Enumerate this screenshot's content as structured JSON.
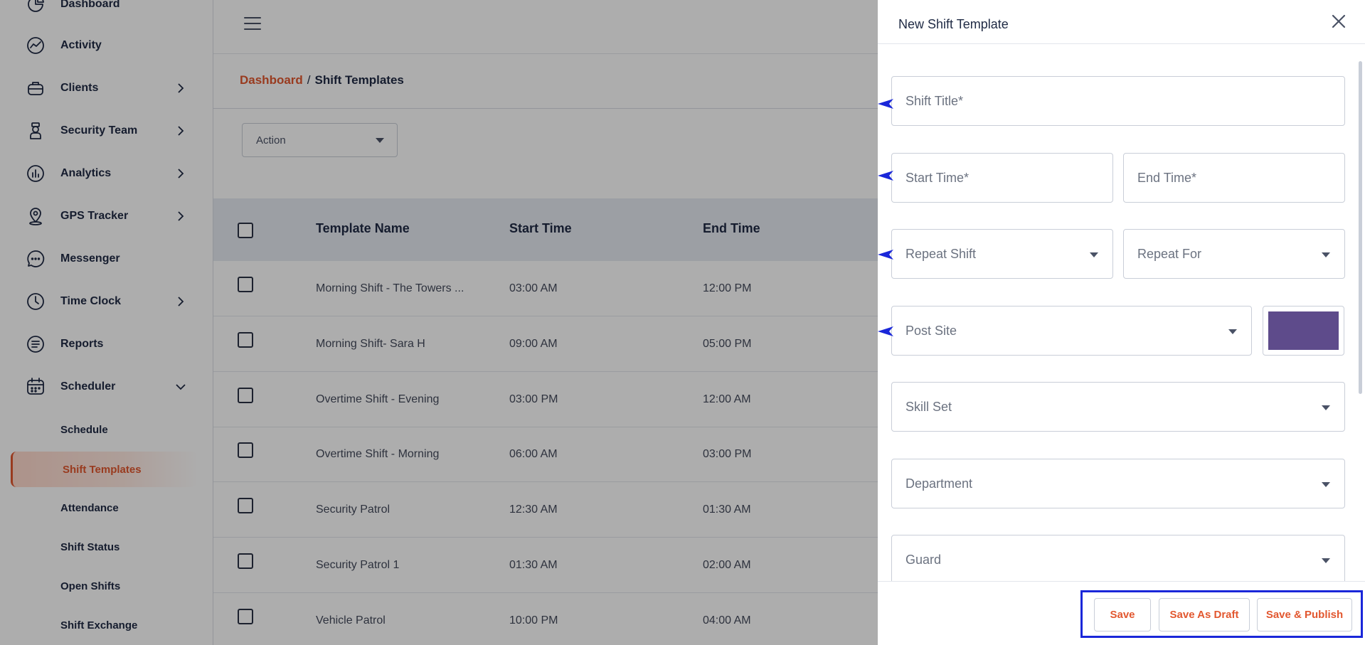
{
  "sidebar": {
    "items": [
      {
        "label": "Dashboard",
        "icon": "dashboard-icon"
      },
      {
        "label": "Activity",
        "icon": "activity-icon"
      },
      {
        "label": "Clients",
        "icon": "briefcase-icon",
        "expandable": true
      },
      {
        "label": "Security Team",
        "icon": "guard-icon",
        "expandable": true
      },
      {
        "label": "Analytics",
        "icon": "analytics-icon",
        "expandable": true
      },
      {
        "label": "GPS Tracker",
        "icon": "map-pin-icon",
        "expandable": true
      },
      {
        "label": "Messenger",
        "icon": "chat-icon"
      },
      {
        "label": "Time Clock",
        "icon": "clock-icon",
        "expandable": true
      },
      {
        "label": "Reports",
        "icon": "reports-icon"
      },
      {
        "label": "Scheduler",
        "icon": "calendar-icon",
        "expanded": true
      }
    ],
    "sub_items": [
      {
        "label": "Schedule"
      },
      {
        "label": "Shift Templates",
        "active": true
      },
      {
        "label": "Attendance"
      },
      {
        "label": "Shift Status"
      },
      {
        "label": "Open Shifts"
      },
      {
        "label": "Shift Exchange"
      }
    ]
  },
  "breadcrumb": {
    "link": "Dashboard",
    "separator": "/",
    "current": "Shift Templates"
  },
  "action_select": {
    "value": "Action"
  },
  "table": {
    "headers": [
      "Template Name",
      "Start Time",
      "End Time"
    ],
    "rows": [
      {
        "name": "Morning Shift - The Towers ...",
        "start": "03:00 AM",
        "end": "12:00 PM"
      },
      {
        "name": "Morning Shift- Sara H",
        "start": "09:00 AM",
        "end": "05:00 PM"
      },
      {
        "name": "Overtime Shift - Evening",
        "start": "03:00 PM",
        "end": "12:00 AM"
      },
      {
        "name": "Overtime Shift - Morning",
        "start": "06:00 AM",
        "end": "03:00 PM"
      },
      {
        "name": "Security Patrol",
        "start": "12:30 AM",
        "end": "01:30 AM"
      },
      {
        "name": "Security Patrol 1",
        "start": "01:30 AM",
        "end": "02:00 AM"
      },
      {
        "name": "Vehicle Patrol",
        "start": "10:00 PM",
        "end": "04:00 AM"
      }
    ]
  },
  "drawer": {
    "title": "New Shift Template",
    "fields": {
      "shift_title": "Shift Title*",
      "start_time": "Start Time*",
      "end_time": "End Time*",
      "repeat_shift": "Repeat Shift",
      "repeat_for": "Repeat For",
      "post_site": "Post Site",
      "skill_set": "Skill Set",
      "department": "Department",
      "guard": "Guard"
    },
    "color": "#5e4b8b",
    "buttons": {
      "save": "Save",
      "save_draft": "Save As Draft",
      "save_publish": "Save & Publish"
    }
  },
  "colors": {
    "accent": "#e2572f",
    "highlight_outline": "#1a27d9",
    "annotation_arrow": "#1a27d9"
  }
}
